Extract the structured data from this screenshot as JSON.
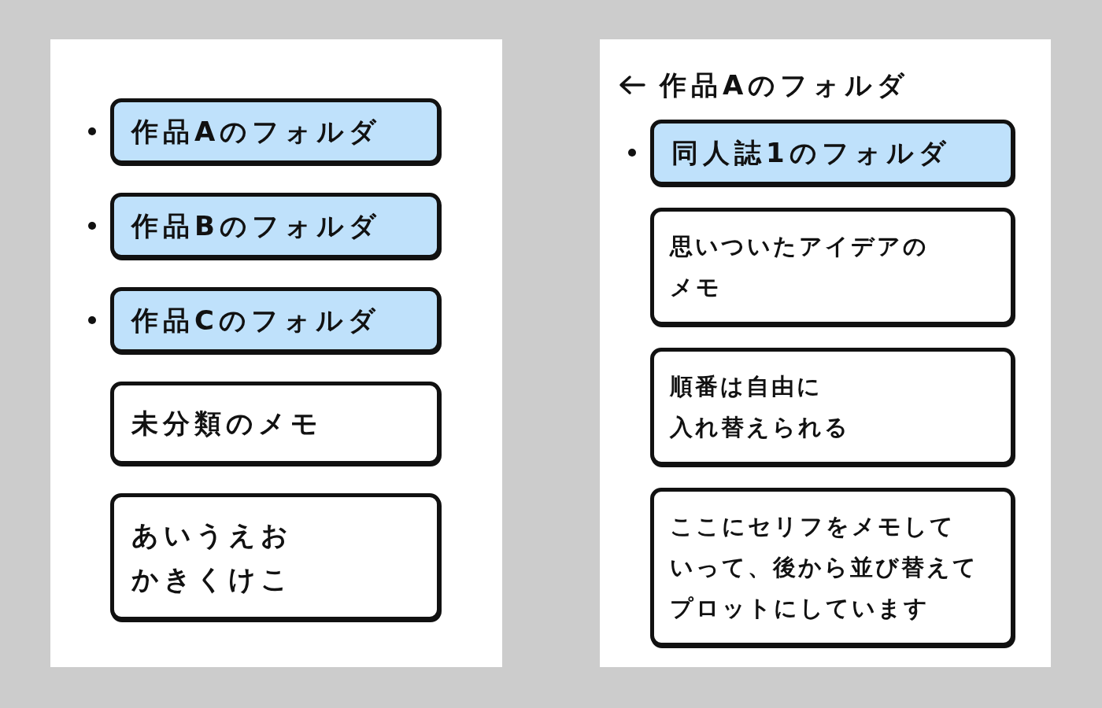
{
  "screens": [
    {
      "items": [
        {
          "kind": "folder",
          "text": "作品Aのフォルダ"
        },
        {
          "kind": "folder",
          "text": "作品Bのフォルダ"
        },
        {
          "kind": "folder",
          "text": "作品Cのフォルダ"
        },
        {
          "kind": "memo",
          "lines": [
            "未分類のメモ"
          ]
        },
        {
          "kind": "memo",
          "lines": [
            "あいうえお",
            "かきくけこ"
          ]
        }
      ]
    },
    {
      "header": {
        "title": "作品Aのフォルダ"
      },
      "items": [
        {
          "kind": "folder",
          "text": "同人誌1のフォルダ"
        },
        {
          "kind": "memo",
          "lines": [
            "思いついたアイデアの",
            "メモ"
          ]
        },
        {
          "kind": "memo",
          "lines": [
            "順番は自由に",
            "入れ替えられる"
          ]
        },
        {
          "kind": "memo",
          "lines": [
            "ここにセリフをメモして",
            "いって、後から並び替えて",
            "プロットにしています"
          ]
        }
      ]
    }
  ]
}
